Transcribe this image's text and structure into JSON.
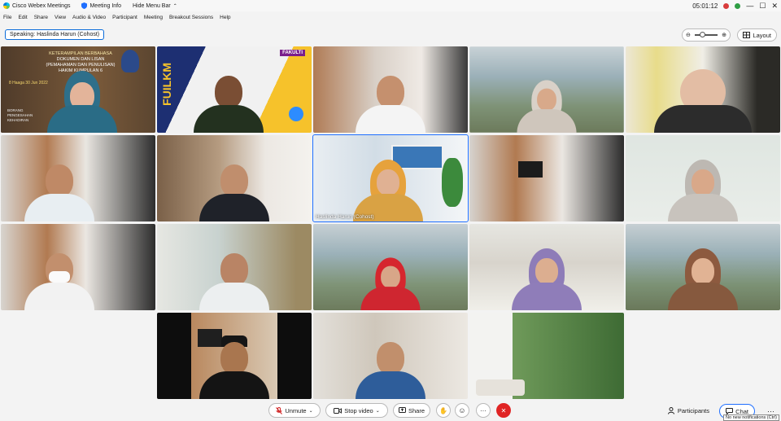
{
  "titlebar": {
    "app_title": "Cisco Webex Meetings",
    "meeting_info": "Meeting Info",
    "hide_menu_bar": "Hide Menu Bar",
    "clock": "05:01:12"
  },
  "menu": [
    "File",
    "Edit",
    "Share",
    "View",
    "Audio & Video",
    "Participant",
    "Meeting",
    "Breakout Sessions",
    "Help"
  ],
  "speaking": "Speaking: Haslinda Harun (Cohost)",
  "layout_label": "Layout",
  "tiles": [
    {
      "name": "tile-1",
      "label": "",
      "active": false
    },
    {
      "name": "tile-2",
      "label": "",
      "active": false
    },
    {
      "name": "tile-3",
      "label": "",
      "active": false
    },
    {
      "name": "tile-4",
      "label": "",
      "active": false
    },
    {
      "name": "tile-5",
      "label": "",
      "active": false
    },
    {
      "name": "tile-6",
      "label": "",
      "active": false
    },
    {
      "name": "tile-7",
      "label": "",
      "active": false
    },
    {
      "name": "tile-8",
      "label": "Haslinda Harun (Cohost)",
      "active": true
    },
    {
      "name": "tile-9",
      "label": "",
      "active": false
    },
    {
      "name": "tile-10",
      "label": "",
      "active": false
    }
  ],
  "poster_text": {
    "line1": "KETERAMPILAN BERBAHASA",
    "line2": "DOKUMEN DAN LISAN",
    "line3": "(PEMAHAMAN DAN PENULISAN)",
    "line4": "HAKIM KUMPULAN 6",
    "line5": "8 Haaga 30 Jun 2022",
    "line6": "BORANG",
    "line7": "PENGESAHAN",
    "line8": "KEHADIRAN"
  },
  "slide_text": {
    "fakulti": "FAKULTI",
    "vertical": "FUILKM"
  },
  "toolbar": {
    "unmute": "Unmute",
    "stop_video": "Stop video",
    "share": "Share",
    "participants": "Participants",
    "chat": "Chat",
    "tooltip": "No new notifications (Ctrl)"
  },
  "colors": {
    "accent": "#1f6fff",
    "end_call": "#e02424",
    "unmute_icon": "#d02020"
  }
}
